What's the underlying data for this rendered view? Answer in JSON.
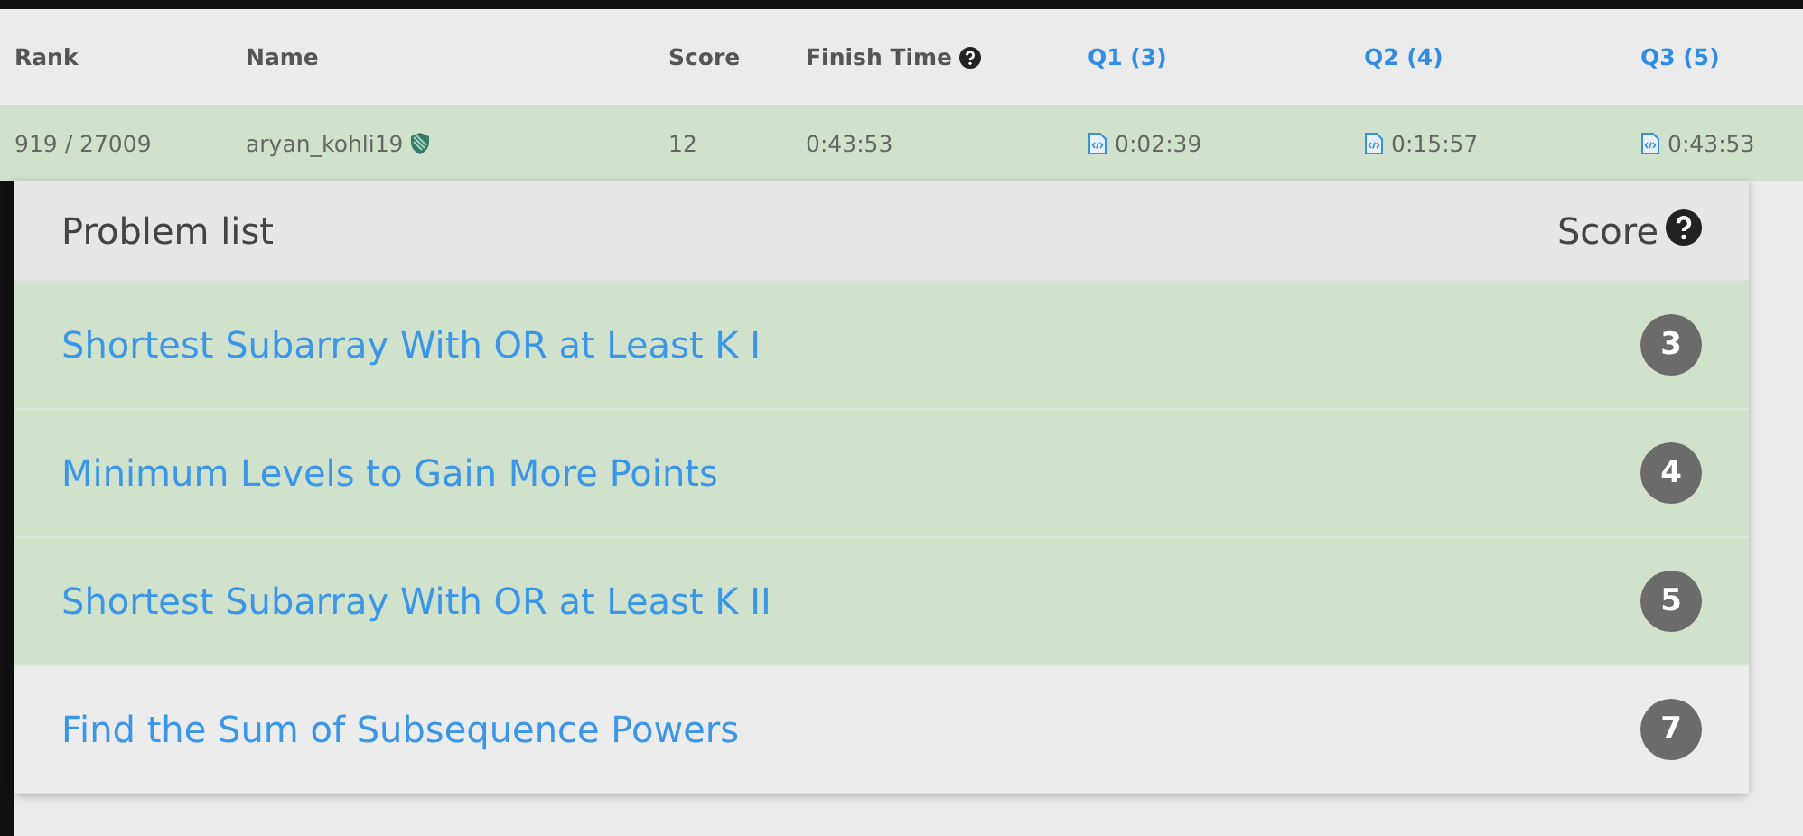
{
  "ranking": {
    "columns": [
      {
        "label": "Rank",
        "kind": "plain"
      },
      {
        "label": "Name",
        "kind": "plain"
      },
      {
        "label": "Score",
        "kind": "plain"
      },
      {
        "label": "Finish Time",
        "kind": "help"
      },
      {
        "label": "Q1 (3)",
        "kind": "link"
      },
      {
        "label": "Q2 (4)",
        "kind": "link"
      },
      {
        "label": "Q3 (5)",
        "kind": "link"
      }
    ],
    "row": {
      "rank": "919 / 27009",
      "name": "aryan_kohli19",
      "score": "12",
      "finish_time": "0:43:53",
      "times": [
        "0:02:39",
        "0:15:57",
        "0:43:53"
      ]
    }
  },
  "problem_list": {
    "title": "Problem list",
    "score_label": "Score",
    "problems": [
      {
        "title": "Shortest Subarray With OR at Least K I",
        "score": "3",
        "solved": true
      },
      {
        "title": "Minimum Levels to Gain More Points",
        "score": "4",
        "solved": true
      },
      {
        "title": "Shortest Subarray With OR at Least K II",
        "score": "5",
        "solved": true
      },
      {
        "title": "Find the Sum of Subsequence Powers",
        "score": "7",
        "solved": false
      }
    ]
  }
}
